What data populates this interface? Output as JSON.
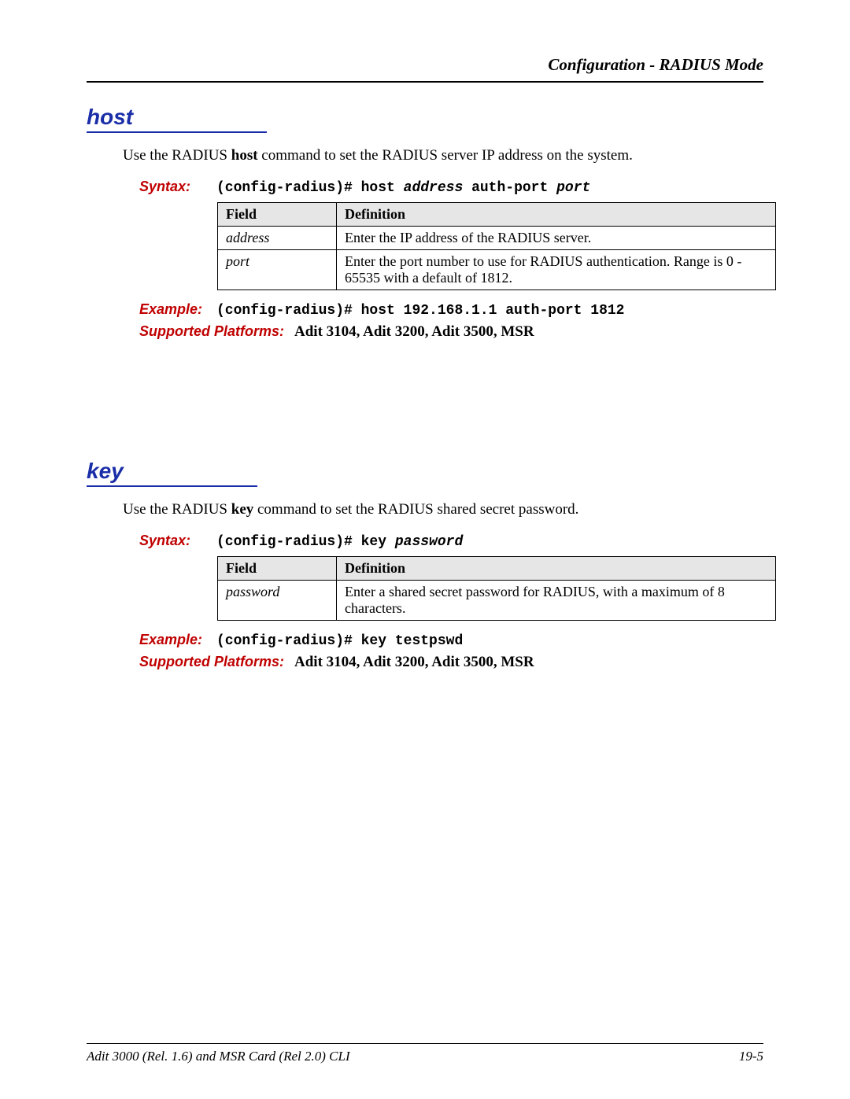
{
  "header": {
    "running_head": "Configuration - RADIUS Mode"
  },
  "sections": {
    "host": {
      "title": "host",
      "intro_pre": "Use the RADIUS ",
      "intro_bold": "host",
      "intro_post": " command to set the RADIUS server IP address on the system.",
      "syntax_label": "Syntax:",
      "syntax_prefix": "(config-radius)# host ",
      "syntax_arg1": "address",
      "syntax_mid": " auth-port ",
      "syntax_arg2": "port",
      "table": {
        "headers": {
          "field": "Field",
          "definition": "Definition"
        },
        "rows": [
          {
            "field": "address",
            "definition": "Enter the IP address of the RADIUS server."
          },
          {
            "field": "port",
            "definition": "Enter the port number to use for RADIUS authentication. Range is 0 - 65535 with a default of 1812."
          }
        ]
      },
      "example_label": "Example:",
      "example": "(config-radius)# host 192.168.1.1 auth-port 1812",
      "platforms_label": "Supported Platforms: ",
      "platforms": "Adit 3104, Adit 3200, Adit 3500, MSR"
    },
    "key": {
      "title": "key",
      "intro_pre": "Use the RADIUS ",
      "intro_bold": "key",
      "intro_post": " command to set the RADIUS shared  secret password.",
      "syntax_label": "Syntax:",
      "syntax_prefix": "(config-radius)# key ",
      "syntax_arg1": "password",
      "table": {
        "headers": {
          "field": "Field",
          "definition": "Definition"
        },
        "rows": [
          {
            "field": "password",
            "definition": "Enter a shared  secret password for RADIUS, with a maximum of 8 characters."
          }
        ]
      },
      "example_label": "Example:",
      "example": "(config-radius)# key testpswd",
      "platforms_label": "Supported Platforms: ",
      "platforms": "Adit 3104, Adit 3200, Adit 3500, MSR"
    }
  },
  "footer": {
    "left": "Adit 3000 (Rel. 1.6) and MSR Card (Rel 2.0) CLI",
    "right": "19-5"
  }
}
